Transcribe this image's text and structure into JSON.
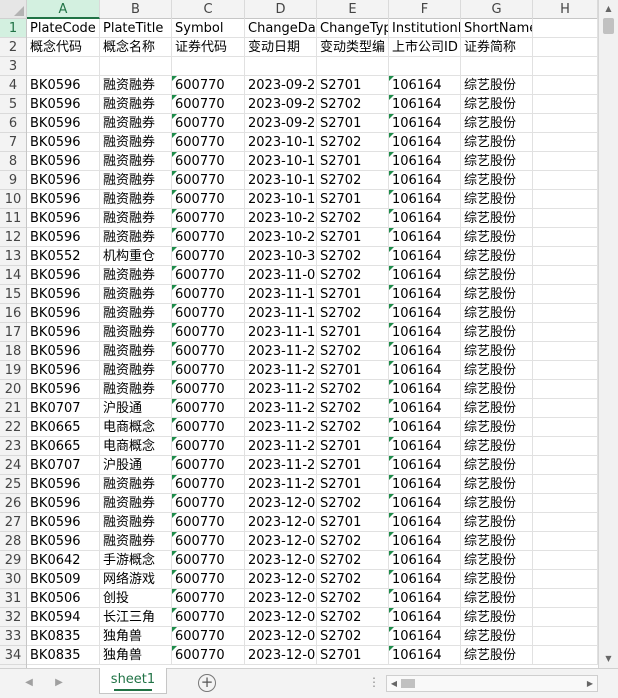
{
  "columns": [
    "A",
    "B",
    "C",
    "D",
    "E",
    "F",
    "G",
    "H"
  ],
  "row_numbers": [
    "1",
    "2",
    "3",
    "4",
    "5",
    "6",
    "7",
    "8",
    "9",
    "10",
    "11",
    "12",
    "13",
    "14",
    "15",
    "16",
    "17",
    "18",
    "19",
    "20",
    "21",
    "22",
    "23",
    "24",
    "25",
    "26",
    "27",
    "28",
    "29",
    "30",
    "31",
    "32",
    "33",
    "34"
  ],
  "headers_en": [
    "PlateCode",
    "PlateTitle",
    "Symbol",
    "ChangeDa",
    "ChangeTyp",
    "InstitutionI",
    "ShortName",
    ""
  ],
  "headers_cn": [
    "概念代码",
    "概念名称",
    "证券代码",
    "变动日期",
    "变动类型编",
    "上市公司ID",
    "证券简称",
    ""
  ],
  "rows": [
    [
      "BK0596",
      "融资融券",
      "600770",
      "2023-09-2",
      "S2701",
      "106164",
      "综艺股份"
    ],
    [
      "BK0596",
      "融资融券",
      "600770",
      "2023-09-2",
      "S2702",
      "106164",
      "综艺股份"
    ],
    [
      "BK0596",
      "融资融券",
      "600770",
      "2023-09-2",
      "S2701",
      "106164",
      "综艺股份"
    ],
    [
      "BK0596",
      "融资融券",
      "600770",
      "2023-10-1",
      "S2702",
      "106164",
      "综艺股份"
    ],
    [
      "BK0596",
      "融资融券",
      "600770",
      "2023-10-1",
      "S2701",
      "106164",
      "综艺股份"
    ],
    [
      "BK0596",
      "融资融券",
      "600770",
      "2023-10-1",
      "S2702",
      "106164",
      "综艺股份"
    ],
    [
      "BK0596",
      "融资融券",
      "600770",
      "2023-10-1",
      "S2701",
      "106164",
      "综艺股份"
    ],
    [
      "BK0596",
      "融资融券",
      "600770",
      "2023-10-2",
      "S2702",
      "106164",
      "综艺股份"
    ],
    [
      "BK0596",
      "融资融券",
      "600770",
      "2023-10-2",
      "S2701",
      "106164",
      "综艺股份"
    ],
    [
      "BK0552",
      "机构重仓",
      "600770",
      "2023-10-3",
      "S2702",
      "106164",
      "综艺股份"
    ],
    [
      "BK0596",
      "融资融券",
      "600770",
      "2023-11-0",
      "S2702",
      "106164",
      "综艺股份"
    ],
    [
      "BK0596",
      "融资融券",
      "600770",
      "2023-11-1",
      "S2701",
      "106164",
      "综艺股份"
    ],
    [
      "BK0596",
      "融资融券",
      "600770",
      "2023-11-1",
      "S2702",
      "106164",
      "综艺股份"
    ],
    [
      "BK0596",
      "融资融券",
      "600770",
      "2023-11-1",
      "S2701",
      "106164",
      "综艺股份"
    ],
    [
      "BK0596",
      "融资融券",
      "600770",
      "2023-11-2",
      "S2702",
      "106164",
      "综艺股份"
    ],
    [
      "BK0596",
      "融资融券",
      "600770",
      "2023-11-2",
      "S2701",
      "106164",
      "综艺股份"
    ],
    [
      "BK0596",
      "融资融券",
      "600770",
      "2023-11-2",
      "S2702",
      "106164",
      "综艺股份"
    ],
    [
      "BK0707",
      "沪股通",
      "600770",
      "2023-11-2",
      "S2702",
      "106164",
      "综艺股份"
    ],
    [
      "BK0665",
      "电商概念",
      "600770",
      "2023-11-2",
      "S2702",
      "106164",
      "综艺股份"
    ],
    [
      "BK0665",
      "电商概念",
      "600770",
      "2023-11-2",
      "S2701",
      "106164",
      "综艺股份"
    ],
    [
      "BK0707",
      "沪股通",
      "600770",
      "2023-11-2",
      "S2701",
      "106164",
      "综艺股份"
    ],
    [
      "BK0596",
      "融资融券",
      "600770",
      "2023-11-2",
      "S2701",
      "106164",
      "综艺股份"
    ],
    [
      "BK0596",
      "融资融券",
      "600770",
      "2023-12-0",
      "S2702",
      "106164",
      "综艺股份"
    ],
    [
      "BK0596",
      "融资融券",
      "600770",
      "2023-12-0",
      "S2701",
      "106164",
      "综艺股份"
    ],
    [
      "BK0596",
      "融资融券",
      "600770",
      "2023-12-0",
      "S2702",
      "106164",
      "综艺股份"
    ],
    [
      "BK0642",
      "手游概念",
      "600770",
      "2023-12-0",
      "S2702",
      "106164",
      "综艺股份"
    ],
    [
      "BK0509",
      "网络游戏",
      "600770",
      "2023-12-0",
      "S2702",
      "106164",
      "综艺股份"
    ],
    [
      "BK0506",
      "创投",
      "600770",
      "2023-12-0",
      "S2702",
      "106164",
      "综艺股份"
    ],
    [
      "BK0594",
      "长江三角",
      "600770",
      "2023-12-0",
      "S2702",
      "106164",
      "综艺股份"
    ],
    [
      "BK0835",
      "独角兽",
      "600770",
      "2023-12-0",
      "S2702",
      "106164",
      "综艺股份"
    ],
    [
      "BK0835",
      "独角兽",
      "600770",
      "2023-12-0",
      "S2701",
      "106164",
      "综艺股份"
    ]
  ],
  "sheet_tab": "sheet1",
  "add_sheet_label": "+",
  "more_dots": "⋮",
  "icons": {
    "scroll_up": "up-arrow-icon",
    "scroll_down": "down-arrow-icon",
    "scroll_left": "left-arrow-icon",
    "scroll_right": "right-arrow-icon"
  },
  "colors": {
    "accent": "#217346",
    "text_marker": "#1e8c4a"
  }
}
